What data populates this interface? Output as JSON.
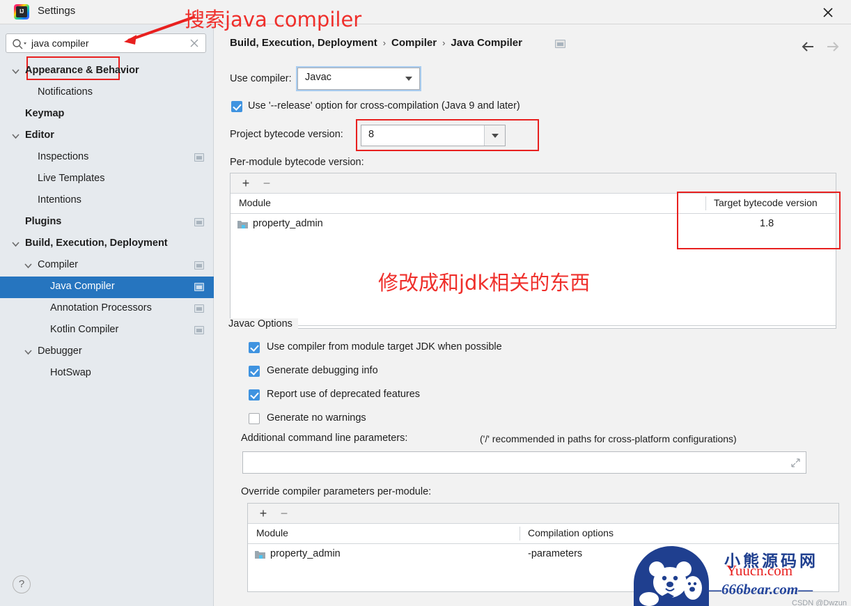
{
  "window": {
    "title": "Settings",
    "logo_icon": "intellij-idea-logo",
    "logo_text": "IJ",
    "close_icon": "close-icon"
  },
  "sidebar": {
    "search": {
      "value": "java compiler",
      "placeholder": "",
      "search_icon": "search-icon",
      "clear_icon": "clear-icon"
    },
    "items": [
      {
        "label": "Appearance & Behavior",
        "indent": 36,
        "bold": true,
        "chevron": true,
        "page_icon": false,
        "selected": false
      },
      {
        "label": "Notifications",
        "indent": 54,
        "bold": false,
        "chevron": false,
        "page_icon": false,
        "selected": false
      },
      {
        "label": "Keymap",
        "indent": 36,
        "bold": true,
        "chevron": false,
        "page_icon": false,
        "selected": false
      },
      {
        "label": "Editor",
        "indent": 36,
        "bold": true,
        "chevron": true,
        "page_icon": false,
        "selected": false
      },
      {
        "label": "Inspections",
        "indent": 54,
        "bold": false,
        "chevron": false,
        "page_icon": true,
        "selected": false
      },
      {
        "label": "Live Templates",
        "indent": 54,
        "bold": false,
        "chevron": false,
        "page_icon": false,
        "selected": false
      },
      {
        "label": "Intentions",
        "indent": 54,
        "bold": false,
        "chevron": false,
        "page_icon": false,
        "selected": false
      },
      {
        "label": "Plugins",
        "indent": 36,
        "bold": true,
        "chevron": false,
        "page_icon": true,
        "selected": false
      },
      {
        "label": "Build, Execution, Deployment",
        "indent": 36,
        "bold": true,
        "chevron": true,
        "page_icon": false,
        "selected": false
      },
      {
        "label": "Compiler",
        "indent": 54,
        "bold": false,
        "chevron": true,
        "page_icon": true,
        "selected": false
      },
      {
        "label": "Java Compiler",
        "indent": 72,
        "bold": false,
        "chevron": false,
        "page_icon": true,
        "selected": true
      },
      {
        "label": "Annotation Processors",
        "indent": 72,
        "bold": false,
        "chevron": false,
        "page_icon": true,
        "selected": false
      },
      {
        "label": "Kotlin Compiler",
        "indent": 72,
        "bold": false,
        "chevron": false,
        "page_icon": true,
        "selected": false
      },
      {
        "label": "Debugger",
        "indent": 54,
        "bold": false,
        "chevron": true,
        "page_icon": false,
        "selected": false
      },
      {
        "label": "HotSwap",
        "indent": 72,
        "bold": false,
        "chevron": false,
        "page_icon": false,
        "selected": false
      }
    ],
    "help_label": "?"
  },
  "main": {
    "breadcrumb": {
      "crumbs": [
        "Build, Execution, Deployment",
        "Compiler",
        "Java Compiler"
      ],
      "separator": "›",
      "page_icon": "settings-page-icon"
    },
    "nav": {
      "back_icon": "arrow-left-icon",
      "forward_icon": "arrow-right-icon"
    },
    "use_compiler_label": "Use compiler:",
    "use_compiler_value": "Javac",
    "release_option_label": "Use '--release' option for cross-compilation (Java 9 and later)",
    "release_option_checked": true,
    "project_bytecode_label": "Project bytecode version:",
    "project_bytecode_value": "8",
    "per_module_label": "Per-module bytecode version:",
    "module_table": {
      "add_label": "+",
      "remove_label": "−",
      "columns": [
        "Module",
        "Target bytecode version"
      ],
      "rows": [
        {
          "module": "property_admin",
          "target": "1.8"
        }
      ]
    },
    "javac_options": {
      "title": "Javac Options",
      "checkboxes": [
        {
          "label": "Use compiler from module target JDK when possible",
          "checked": true
        },
        {
          "label": "Generate debugging info",
          "checked": true
        },
        {
          "label": "Report use of deprecated features",
          "checked": true
        },
        {
          "label": "Generate no warnings",
          "checked": false
        }
      ],
      "additional_params_label": "Additional command line parameters:",
      "additional_params_hint": "('/' recommended in paths for cross-platform configurations)",
      "additional_params_value": "",
      "expand_icon": "expand-icon",
      "override_label": "Override compiler parameters per-module:",
      "override_table": {
        "add_label": "+",
        "remove_label": "−",
        "columns": [
          "Module",
          "Compilation options"
        ],
        "rows": [
          {
            "module": "property_admin",
            "options": "-parameters"
          }
        ]
      }
    }
  },
  "annotations": {
    "top_text": "搜索java compiler",
    "middle_text": "修改成和jdk相关的东西",
    "color": "#ef2f2b"
  },
  "watermark": {
    "site_cn": "小熊源码网",
    "site_en": "Yuucn.com",
    "site_alt": "—666bear.com—",
    "credit": "CSDN @Dwzun",
    "bear_icon": "bear-logo-icon"
  }
}
